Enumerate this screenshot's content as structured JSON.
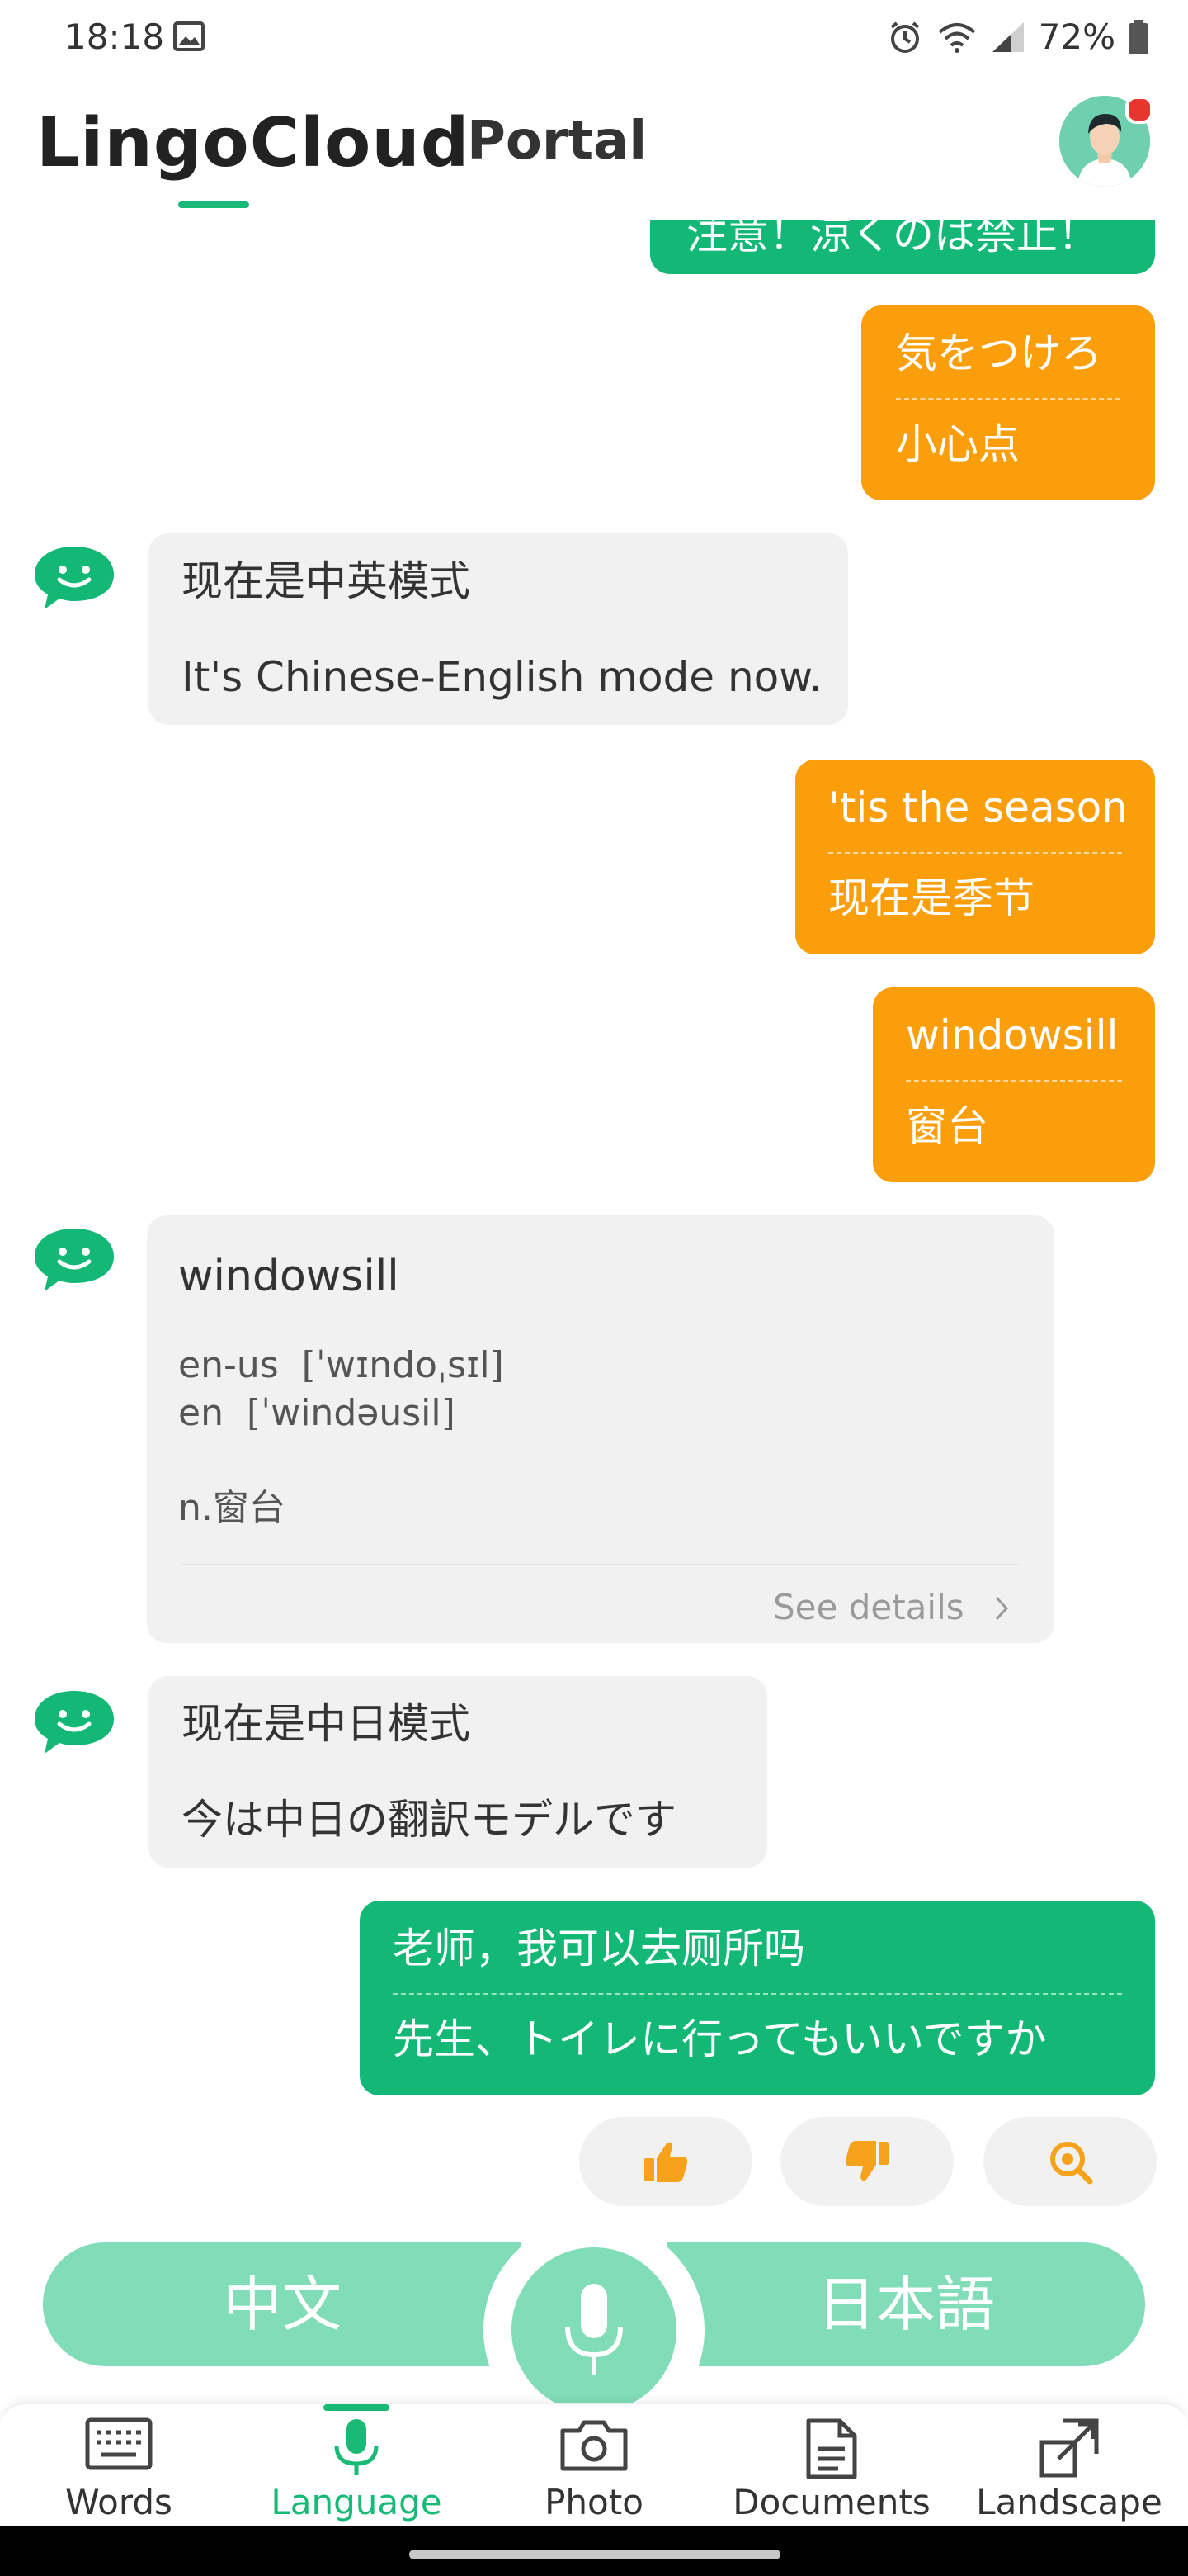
{
  "status": {
    "time": "18:18",
    "battery": "72%"
  },
  "header": {
    "title": "LingoCloud",
    "portal": "Portal"
  },
  "messages": {
    "top_partial": "注意！涼くのは禁止！",
    "m1_src": "気をつけろ",
    "m1_tr": "小心点",
    "bot1_a": "现在是中英模式",
    "bot1_b": "It's Chinese-English mode now.",
    "m2_src": "'tis the season",
    "m2_tr": "现在是季节",
    "m3_src": "windowsill",
    "m3_tr": "窗台",
    "bot2_a": "现在是中日模式",
    "bot2_b": "今は中日の翻訳モデルです",
    "m4_src": "老师，我可以去厕所吗",
    "m4_tr": "先生、トイレに行ってもいいですか"
  },
  "dictionary": {
    "word": "windowsill",
    "us_label": "en-us",
    "us_phon": "[ˈwɪndoˌsɪl]",
    "uk_label": "en",
    "uk_phon": "[ˈwindəusil]",
    "definition": "n.窗台",
    "see_details": "See details"
  },
  "language_bar": {
    "left": "中文",
    "right": "日本語"
  },
  "nav": {
    "words": "Words",
    "language": "Language",
    "photo": "Photo",
    "documents": "Documents",
    "landscape": "Landscape"
  },
  "colors": {
    "green": "#13b877",
    "orange": "#fb9e0b",
    "light_green": "#81dcb8"
  }
}
